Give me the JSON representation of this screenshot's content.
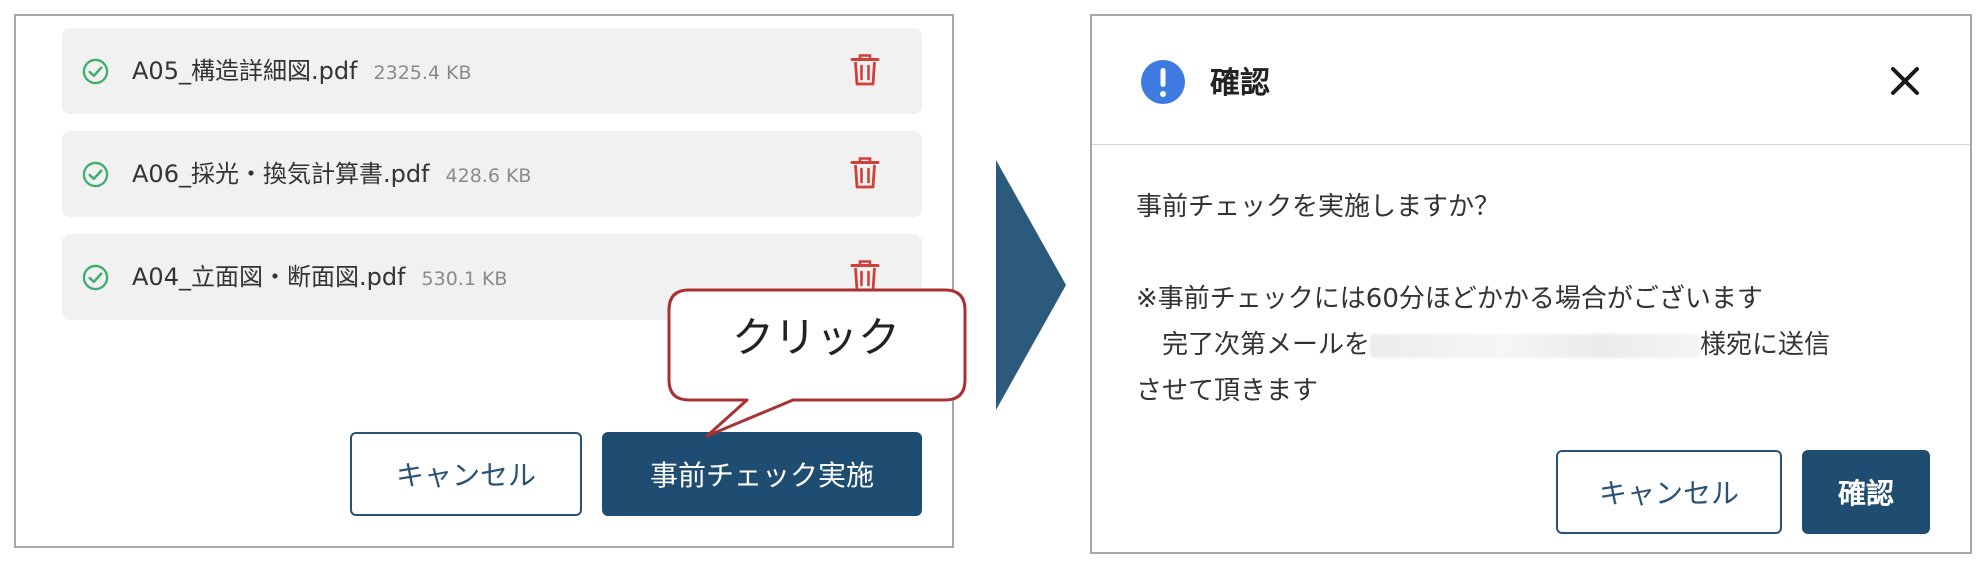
{
  "left": {
    "files": [
      {
        "name": "A05_構造詳細図.pdf",
        "size": "2325.4 KB"
      },
      {
        "name": "A06_採光・換気計算書.pdf",
        "size": "428.6 KB"
      },
      {
        "name": "A04_立面図・断面図.pdf",
        "size": "530.1 KB"
      }
    ],
    "cancel_label": "キャンセル",
    "submit_label": "事前チェック実施",
    "callout_text": "クリック"
  },
  "dialog": {
    "title": "確認",
    "message_line1": "事前チェックを実施しますか？",
    "message_line2": "※事前チェックには60分ほどかかる場合がございます",
    "message_line3_prefix": "　完了次第メールを",
    "message_line3_suffix": "様宛に送信",
    "message_line4": "させて頂きます",
    "cancel_label": "キャンセル",
    "confirm_label": "確認"
  },
  "colors": {
    "primary": "#1f4d72",
    "check_green": "#3fae6a",
    "trash_red": "#d0403a",
    "info_blue": "#3d7be0",
    "callout_border": "#a83232",
    "arrow": "#2c5a7c"
  },
  "icons": [
    "check-circle-icon",
    "trash-icon",
    "info-icon",
    "close-icon",
    "flow-arrow-icon"
  ]
}
